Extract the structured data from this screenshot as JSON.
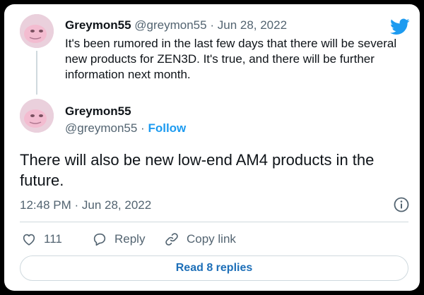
{
  "reply_tweet": {
    "display_name": "Greymon55",
    "handle": "@greymon55",
    "separator": "·",
    "date": "Jun 28, 2022",
    "text": "It's been rumored in the last few days that there will be several new products for ZEN3D. It's true, and there will be further information next month."
  },
  "main_tweet": {
    "display_name": "Greymon55",
    "handle": "@greymon55",
    "separator": "·",
    "follow_label": "Follow",
    "text": "There will also be new low-end AM4 products in the future.",
    "timestamp": "12:48 PM · Jun 28, 2022"
  },
  "actions": {
    "like_count": "111",
    "reply_label": "Reply",
    "copy_link_label": "Copy link"
  },
  "read_replies_label": "Read 8 replies",
  "colors": {
    "accent": "#1d9bf0",
    "text": "#0f1419",
    "muted": "#536471",
    "border": "#cfd9de"
  },
  "icons": [
    "twitter-logo-icon",
    "info-icon",
    "heart-icon",
    "reply-icon",
    "link-icon"
  ]
}
